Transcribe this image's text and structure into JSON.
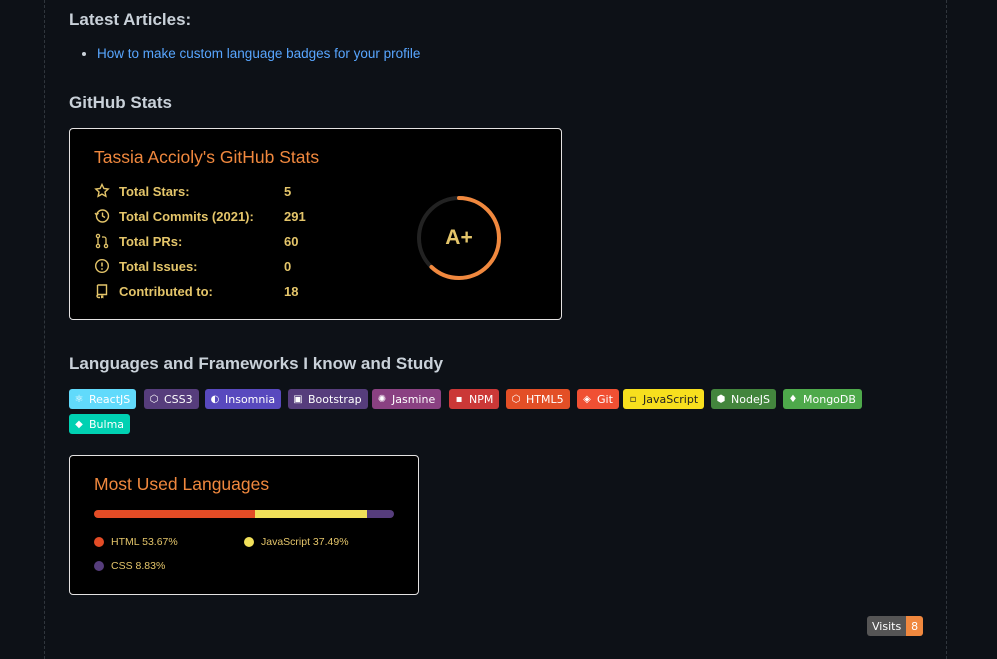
{
  "latest": {
    "heading": "Latest Articles:",
    "articles": [
      "How to make custom language badges for your profile"
    ]
  },
  "github_stats": {
    "heading": "GitHub Stats",
    "card_title": "Tassia Accioly's GitHub Stats",
    "rows": [
      {
        "icon": "star-icon",
        "label": "Total Stars:",
        "value": "5"
      },
      {
        "icon": "history-icon",
        "label": "Total Commits (2021):",
        "value": "291"
      },
      {
        "icon": "pull-request-icon",
        "label": "Total PRs:",
        "value": "60"
      },
      {
        "icon": "issue-icon",
        "label": "Total Issues:",
        "value": "0"
      },
      {
        "icon": "repo-icon",
        "label": "Contributed to:",
        "value": "18"
      }
    ],
    "rank": "A+",
    "rank_progress": 0.62,
    "colors": {
      "title": "#f0883e",
      "text": "#e4c56a",
      "ring": "#f0883e"
    }
  },
  "languages_section": {
    "heading": "Languages and Frameworks I know and Study",
    "badges": [
      {
        "label": "ReactJS",
        "color": "#61dafb",
        "icon": "react-icon"
      },
      {
        "label": "CSS3",
        "color": "#563d7c",
        "icon": "css3-icon"
      },
      {
        "label": "Insomnia",
        "color": "#5849be",
        "icon": "insomnia-icon"
      },
      {
        "label": "Bootstrap",
        "color": "#563d7c",
        "icon": "bootstrap-icon"
      },
      {
        "label": "Jasmine",
        "color": "#8a4182",
        "icon": "jasmine-icon"
      },
      {
        "label": "NPM",
        "color": "#cb3837",
        "icon": "npm-icon"
      },
      {
        "label": "HTML5",
        "color": "#e34f26",
        "icon": "html5-icon"
      },
      {
        "label": "Git",
        "color": "#f05033",
        "icon": "git-icon"
      },
      {
        "label": "JavaScript",
        "color": "#f7df1e",
        "icon": "javascript-icon"
      },
      {
        "label": "NodeJS",
        "color": "#43853d",
        "icon": "nodejs-icon"
      },
      {
        "label": "MongoDB",
        "color": "#4ea94b",
        "icon": "mongodb-icon"
      },
      {
        "label": "Bulma",
        "color": "#00d1b2",
        "icon": "bulma-icon"
      }
    ]
  },
  "top_langs": {
    "title": "Most Used Languages",
    "langs": [
      {
        "name": "HTML",
        "percent": 53.67,
        "display": "HTML 53.67%",
        "color": "#e34c26"
      },
      {
        "name": "JavaScript",
        "percent": 37.49,
        "display": "JavaScript 37.49%",
        "color": "#f1e05a"
      },
      {
        "name": "CSS",
        "percent": 8.83,
        "display": "CSS 8.83%",
        "color": "#563d7c"
      }
    ]
  },
  "visits": {
    "label": "Visits",
    "count": "8"
  }
}
